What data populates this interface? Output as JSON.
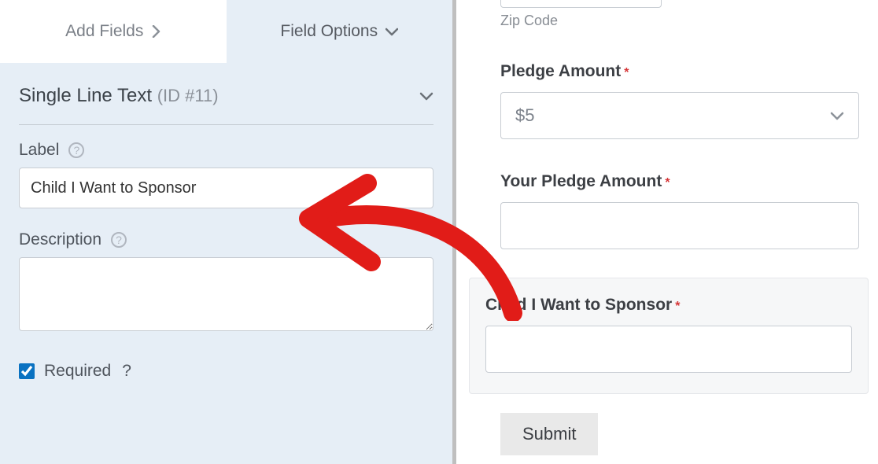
{
  "tabs": {
    "add_fields": "Add Fields",
    "field_options": "Field Options"
  },
  "panel": {
    "title": "Single Line Text",
    "id_text": "(ID #11)",
    "label_heading": "Label",
    "label_value": "Child I Want to Sponsor",
    "description_heading": "Description",
    "description_value": "",
    "required_label": "Required",
    "required_checked": true
  },
  "preview": {
    "zip_label": "Zip Code",
    "pledge_amount_label": "Pledge Amount",
    "pledge_amount_value": "$5",
    "your_pledge_label": "Your Pledge Amount",
    "your_pledge_value": "",
    "child_sponsor_label": "Child I Want to Sponsor",
    "child_sponsor_value": "",
    "submit_label": "Submit"
  },
  "colors": {
    "panel_bg": "#e6eef6",
    "accent_red": "#e11c18"
  }
}
